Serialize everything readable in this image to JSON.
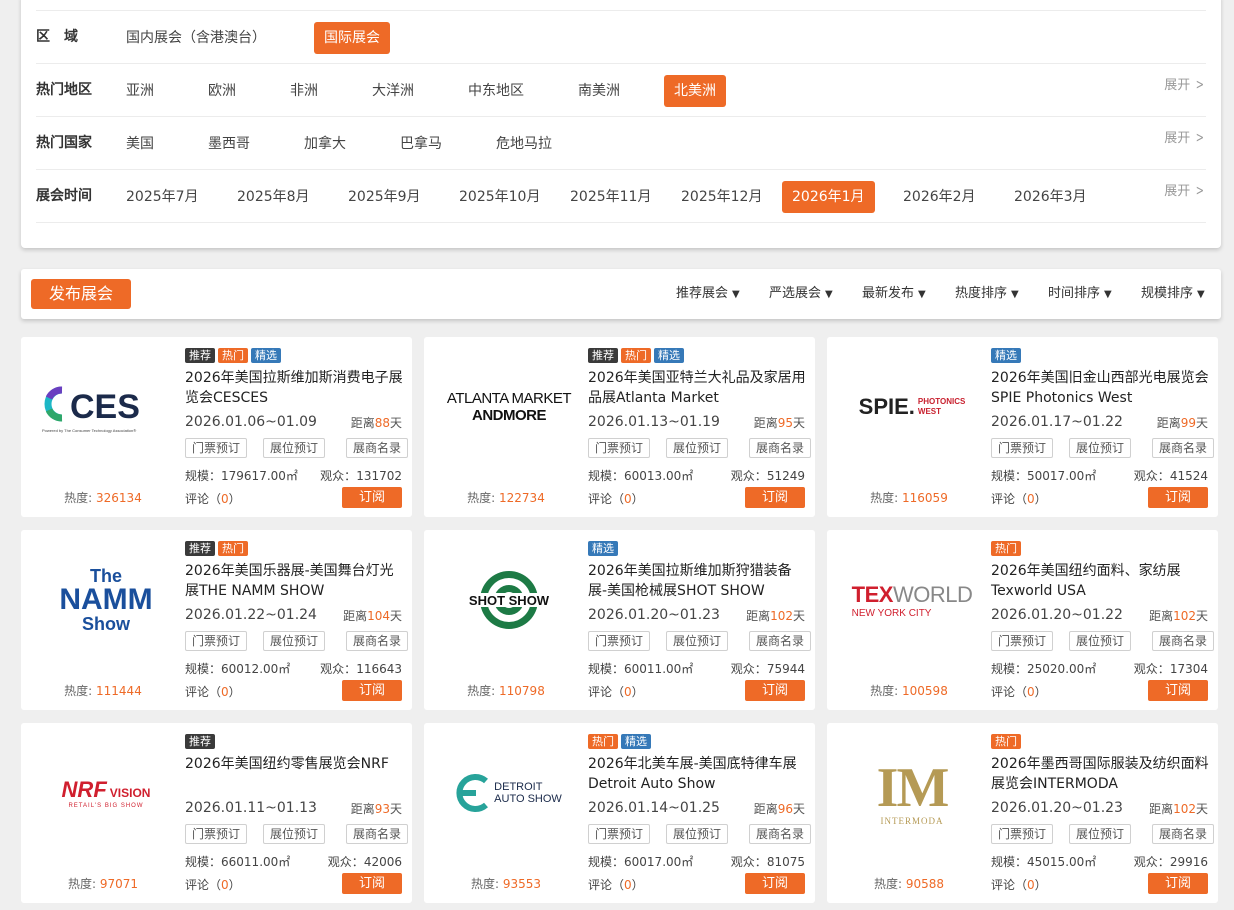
{
  "filters": {
    "region": {
      "label": "区　域",
      "options": [
        "国内展会（含港澳台）",
        "国际展会"
      ],
      "active": 1
    },
    "hot_areas": {
      "label": "热门地区",
      "options": [
        "亚洲",
        "欧洲",
        "非洲",
        "大洋洲",
        "中东地区",
        "南美洲",
        "北美洲"
      ],
      "active": 6,
      "expand": "展开"
    },
    "hot_countries": {
      "label": "热门国家",
      "options": [
        "美国",
        "墨西哥",
        "加拿大",
        "巴拿马",
        "危地马拉"
      ],
      "active": -1,
      "expand": "展开"
    },
    "time": {
      "label": "展会时间",
      "options": [
        "2025年7月",
        "2025年8月",
        "2025年9月",
        "2025年10月",
        "2025年11月",
        "2025年12月",
        "2026年1月",
        "2026年2月",
        "2026年3月"
      ],
      "active": 6,
      "expand": "展开"
    }
  },
  "toolbar": {
    "publish_label": "发布展会",
    "sorts": [
      "推荐展会",
      "严选展会",
      "最新发布",
      "热度排序",
      "时间排序",
      "规模排序"
    ]
  },
  "card_labels": {
    "heat": "热度: ",
    "dist_prefix": "距离",
    "dist_suffix": "天",
    "ticket": "门票预订",
    "booth": "展位预订",
    "exhibitors": "展商名录",
    "scale_prefix": "规模：",
    "audience_prefix": "观众：",
    "comment": "评论",
    "subscribe": "订阅"
  },
  "tag_names": {
    "rec": "推荐",
    "hot": "热门",
    "sel": "精选"
  },
  "colors": {
    "accent": "#ee6a27",
    "tag_recommend": "#3a3a3a",
    "tag_selected": "#3679b8"
  },
  "cards": [
    {
      "logo": "ces-logo",
      "tags": [
        "rec",
        "hot",
        "sel"
      ],
      "title": "2026年美国拉斯维加斯消费电子展览会CESCES",
      "date": "2026.01.06~01.09",
      "dist": "88",
      "scale": "179617.00㎡",
      "audience": "131702",
      "heat": "326134",
      "comments": "0"
    },
    {
      "logo": "atlanta-market-logo",
      "tags": [
        "rec",
        "hot",
        "sel"
      ],
      "title": "2026年美国亚特兰大礼品及家居用品展Atlanta Market",
      "date": "2026.01.13~01.19",
      "dist": "95",
      "scale": "60013.00㎡",
      "audience": "51249",
      "heat": "122734",
      "comments": "0"
    },
    {
      "logo": "spie-logo",
      "tags": [
        "sel"
      ],
      "title": "2026年美国旧金山西部光电展览会SPIE Photonics West",
      "date": "2026.01.17~01.22",
      "dist": "99",
      "scale": "50017.00㎡",
      "audience": "41524",
      "heat": "116059",
      "comments": "0"
    },
    {
      "logo": "namm-logo",
      "tags": [
        "rec",
        "hot"
      ],
      "title": "2026年美国乐器展-美国舞台灯光展THE NAMM SHOW",
      "date": "2026.01.22~01.24",
      "dist": "104",
      "scale": "60012.00㎡",
      "audience": "116643",
      "heat": "111444",
      "comments": "0"
    },
    {
      "logo": "shot-show-logo",
      "tags": [
        "sel"
      ],
      "title": "2026年美国拉斯维加斯狩猎装备展-美国枪械展SHOT SHOW",
      "date": "2026.01.20~01.23",
      "dist": "102",
      "scale": "60011.00㎡",
      "audience": "75944",
      "heat": "110798",
      "comments": "0"
    },
    {
      "logo": "texworld-logo",
      "tags": [
        "hot"
      ],
      "title": "2026年美国纽约面料、家纺展Texworld USA",
      "date": "2026.01.20~01.22",
      "dist": "102",
      "scale": "25020.00㎡",
      "audience": "17304",
      "heat": "100598",
      "comments": "0"
    },
    {
      "logo": "nrf-logo",
      "tags": [
        "rec"
      ],
      "title": "2026年美国纽约零售展览会NRF",
      "date": "2026.01.11~01.13",
      "dist": "93",
      "scale": "66011.00㎡",
      "audience": "42006",
      "heat": "97071",
      "comments": "0"
    },
    {
      "logo": "detroit-logo",
      "tags": [
        "hot",
        "sel"
      ],
      "title": "2026年北美车展-美国底特律车展Detroit Auto Show",
      "date": "2026.01.14~01.25",
      "dist": "96",
      "scale": "60017.00㎡",
      "audience": "81075",
      "heat": "93553",
      "comments": "0"
    },
    {
      "logo": "intermoda-logo",
      "tags": [
        "hot"
      ],
      "title": "2026年墨西哥国际服装及纺织面料展览会INTERMODA",
      "date": "2026.01.20~01.23",
      "dist": "102",
      "scale": "45015.00㎡",
      "audience": "29916",
      "heat": "90588",
      "comments": "0"
    }
  ],
  "logos": {
    "ces": {
      "text": "CES",
      "sub": "Powered by The Consumer Technology Association®"
    },
    "atlanta": {
      "line1": "ATLANTA MARKET",
      "line2": "ANDMORE"
    },
    "spie": {
      "main": "SPIE.",
      "sub1": "PHOTONICS",
      "sub2": "WEST"
    },
    "namm": {
      "line1": "The",
      "line2": "NAMM",
      "line3": "Show"
    },
    "shot": {
      "text": "SHOT SHOW"
    },
    "texworld": {
      "tex": "TEX",
      "world": "WORLD",
      "sub": "NEW YORK CITY"
    },
    "nrf": {
      "main": "NRF",
      "vision": "VISION",
      "sub": "RETAIL'S BIG SHOW"
    },
    "detroit": {
      "line1": "DETROIT",
      "line2": "AUTO SHOW"
    },
    "intermoda": {
      "main": "IM",
      "sub": "INTERMODA"
    }
  }
}
